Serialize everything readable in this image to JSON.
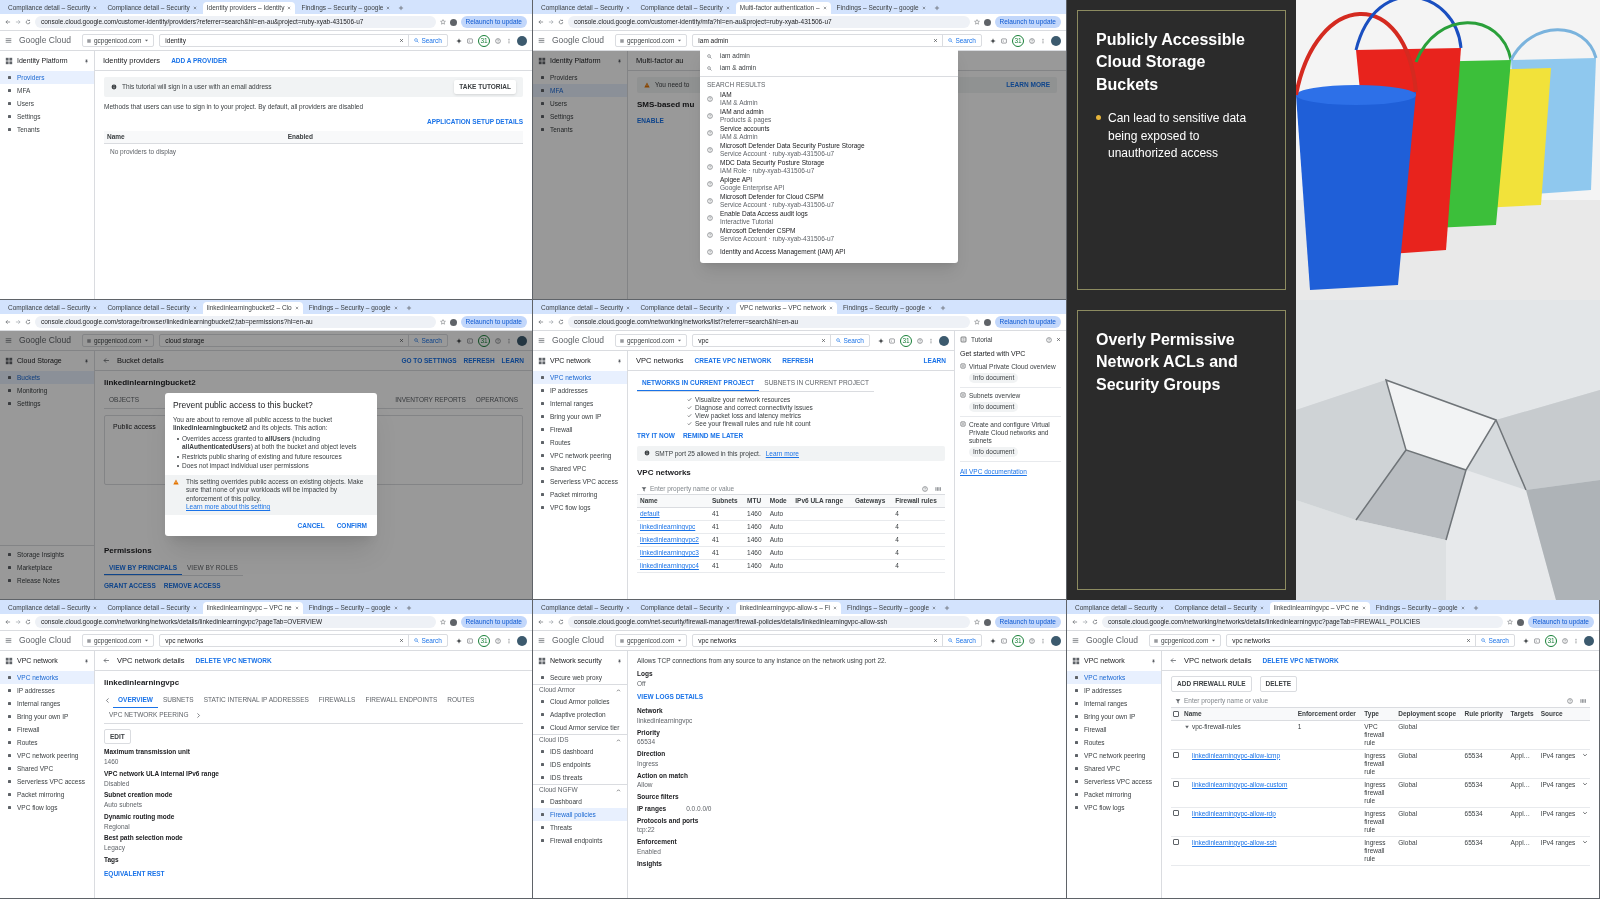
{
  "tiles": [
    {
      "kind": "browser",
      "tabs": [
        {
          "title": "Compliance detail – Security",
          "selected": false
        },
        {
          "title": "Compliance detail – Security",
          "selected": false
        },
        {
          "title": "Identity providers – Identity",
          "selected": true
        },
        {
          "title": "Findings – Security – google",
          "selected": false
        }
      ],
      "url": "console.cloud.google.com/customer-identity/providers?referrer=search&hl=en-au&project=ruby-xyab-431506-u7",
      "project": "gcpgenicod.com",
      "logo": "Google Cloud",
      "search": "identity",
      "search_button": "Search",
      "notifications": "31",
      "relaunch": "Relaunch to update",
      "product": "Identity Platform",
      "sidebar": [
        {
          "label": "Providers",
          "selected": true
        },
        {
          "label": "MFA",
          "selected": false
        },
        {
          "label": "Users",
          "selected": false
        },
        {
          "label": "Settings",
          "selected": false
        },
        {
          "label": "Tenants",
          "selected": false
        }
      ],
      "header": {
        "title": "Identity providers",
        "actions": [
          {
            "text": "ADD A PROVIDER"
          }
        ]
      },
      "blocks": [
        {
          "kind": "banner",
          "text": "This tutorial will sign in a user with an email address",
          "action": "TAKE TUTORIAL"
        },
        {
          "kind": "text",
          "text": "Methods that users can use to sign in to your project. By default, all providers are disabled"
        },
        {
          "kind": "action-right",
          "text": "APPLICATION SETUP DETAILS"
        },
        {
          "kind": "table",
          "columns": [
            "Name",
            "Enabled"
          ],
          "empty": "No providers to display"
        }
      ]
    },
    {
      "kind": "browser",
      "tabs": [
        {
          "title": "Compliance detail – Security",
          "selected": false
        },
        {
          "title": "Compliance detail – Security",
          "selected": false
        },
        {
          "title": "Multi-factor authentication –",
          "selected": true
        },
        {
          "title": "Findings – Security – google",
          "selected": false
        }
      ],
      "url": "console.cloud.google.com/customer-identity/mfa?hl=en-au&project=ruby-xyab-431506-u7",
      "project": "gcpgenicod.com",
      "logo": "Google Cloud",
      "search": "iam admin",
      "search_button": "Search",
      "notifications": "31",
      "relaunch": "Relaunch to update",
      "product": "Identity Platform",
      "sidebar": [
        {
          "label": "Providers",
          "selected": false
        },
        {
          "label": "MFA",
          "selected": true
        },
        {
          "label": "Users",
          "selected": false
        },
        {
          "label": "Settings",
          "selected": false
        },
        {
          "label": "Tenants",
          "selected": false
        }
      ],
      "header": {
        "title": "Multi-factor au"
      },
      "blocks": [
        {
          "kind": "banner-warning",
          "text": "You need to",
          "action": "LEARN MORE"
        },
        {
          "kind": "heading",
          "text": "SMS-based mu"
        },
        {
          "kind": "action",
          "text": "ENABLE"
        }
      ],
      "overlay": {
        "kind": "dropdown",
        "suggestions": [
          "iam admin",
          "iam & admin"
        ],
        "section": "SEARCH RESULTS",
        "results": [
          {
            "title": "IAM",
            "subtitle": "IAM & Admin"
          },
          {
            "title": "IAM and admin",
            "subtitle": "Products & pages"
          },
          {
            "title": "Service accounts",
            "subtitle": "IAM & Admin"
          },
          {
            "title": "Microsoft Defender Data Security Posture Storage",
            "subtitle": "Service Account · ruby-xyab-431506-u7"
          },
          {
            "title": "MDC Data Security Posture Storage",
            "subtitle": "IAM Role · ruby-xyab-431506-u7"
          },
          {
            "title": "Apigee API",
            "subtitle": "Google Enterprise API"
          },
          {
            "title": "Microsoft Defender for Cloud CSPM",
            "subtitle": "Service Account · ruby-xyab-431506-u7"
          },
          {
            "title": "Enable Data Access audit logs",
            "subtitle": "Interactive Tutorial"
          },
          {
            "title": "Microsoft Defender CSPM",
            "subtitle": "Service Account · ruby-xyab-431506-u7"
          },
          {
            "title": "Identity and Access Management (IAM) API"
          }
        ]
      }
    },
    {
      "kind": "slide",
      "title": "Publicly Accessible Cloud Storage Buckets",
      "bullets": [
        "Can lead to sensitive data being exposed to unauthorized access"
      ]
    },
    {
      "kind": "browser",
      "tabs": [
        {
          "title": "Compliance detail – Security",
          "selected": false
        },
        {
          "title": "Compliance detail – Security",
          "selected": false
        },
        {
          "title": "linkedinlearningbucket2 – Clo",
          "selected": true
        },
        {
          "title": "Findings – Security – google",
          "selected": false
        }
      ],
      "url": "console.cloud.google.com/storage/browser/linkedinlearningbucket2;tab=permissions?hl=en-au",
      "project": "gcpgenicod.com",
      "logo": "Google Cloud",
      "search": "cloud storage",
      "search_button": "Search",
      "notifications": "31",
      "relaunch": "Relaunch to update",
      "product": "Cloud Storage",
      "sidebar": [
        {
          "label": "Buckets",
          "selected": true
        },
        {
          "label": "Monitoring",
          "selected": false
        },
        {
          "label": "Settings",
          "selected": false
        }
      ],
      "sidebar_bottom": [
        {
          "label": "Storage Insights",
          "selected": false
        },
        {
          "label": "Marketplace",
          "selected": false
        },
        {
          "label": "Release Notes",
          "selected": false
        }
      ],
      "header": {
        "title": "Bucket details",
        "back": true,
        "right_actions": [
          {
            "text": "GO TO SETTINGS"
          },
          {
            "text": "REFRESH"
          },
          {
            "text": "LEARN"
          }
        ]
      },
      "blocks": [
        {
          "kind": "heading",
          "text": "linkedinlearningbucket2"
        },
        {
          "kind": "tabs",
          "items": [
            {
              "label": "OBJECTS",
              "selected": false
            },
            {
              "label": "INVENTORY REPORTS",
              "selected": false,
              "gap_before": true
            },
            {
              "label": "OPERATIONS",
              "selected": false
            }
          ]
        },
        {
          "kind": "card",
          "heading": "Public access"
        }
      ],
      "footer_blocks": [
        {
          "kind": "heading",
          "text": "Permissions"
        },
        {
          "kind": "tabs",
          "items": [
            {
              "label": "VIEW BY PRINCIPALS",
              "selected": true
            },
            {
              "label": "VIEW BY ROLES",
              "selected": false
            }
          ]
        },
        {
          "kind": "buttons",
          "items": [
            "GRANT ACCESS",
            "REMOVE ACCESS"
          ]
        }
      ],
      "overlay": {
        "kind": "modal",
        "title": "Prevent public access to this bucket?",
        "text": "You are about to remove all public access to the bucket **linkedinlearningbucket2** and its objects. This action:",
        "bullets": [
          "Overrides access granted to **allUsers** (including **allAuthenticatedUsers**) at both the bucket and object levels",
          "Restricts public sharing of existing and future resources",
          "Does not impact individual user permissions"
        ],
        "warning": "This setting overrides public access on existing objects. Make sure that none of your workloads will be impacted by enforcement of this policy.",
        "warning_link": "Learn more about this setting",
        "buttons": [
          "CANCEL",
          "CONFIRM"
        ]
      }
    },
    {
      "kind": "browser",
      "tabs": [
        {
          "title": "Compliance detail – Security",
          "selected": false
        },
        {
          "title": "Compliance detail – Security",
          "selected": false
        },
        {
          "title": "VPC networks – VPC network",
          "selected": true
        },
        {
          "title": "Findings – Security – google",
          "selected": false
        }
      ],
      "url": "console.cloud.google.com/networking/networks/list?referrer=search&hl=en-au",
      "project": "gcpgenicod.com",
      "logo": "Google Cloud",
      "search": "vpc",
      "search_button": "Search",
      "notifications": "31",
      "relaunch": "Relaunch to update",
      "product": "VPC network",
      "sidebar": [
        {
          "label": "VPC networks",
          "selected": true
        },
        {
          "label": "IP addresses",
          "selected": false
        },
        {
          "label": "Internal ranges",
          "selected": false
        },
        {
          "label": "Bring your own IP",
          "selected": false
        },
        {
          "label": "Firewall",
          "selected": false
        },
        {
          "label": "Routes",
          "selected": false
        },
        {
          "label": "VPC network peering",
          "selected": false
        },
        {
          "label": "Shared VPC",
          "selected": false
        },
        {
          "label": "Serverless VPC access",
          "selected": false
        },
        {
          "label": "Packet mirroring",
          "selected": false
        },
        {
          "label": "VPC flow logs",
          "selected": false
        }
      ],
      "header": {
        "title": "VPC networks",
        "actions": [
          {
            "text": "CREATE VPC NETWORK"
          },
          {
            "text": "REFRESH"
          }
        ],
        "right_actions": [
          {
            "text": "LEARN"
          }
        ]
      },
      "blocks": [
        {
          "kind": "tabs",
          "items": [
            {
              "label": "NETWORKS IN CURRENT PROJECT",
              "selected": true
            },
            {
              "label": "SUBNETS IN CURRENT PROJECT",
              "selected": false
            }
          ]
        },
        {
          "kind": "checklist",
          "items": [
            "Visualize your network resources",
            "Diagnose and correct connectivity issues",
            "View packet loss and latency metrics",
            "See your firewall rules and rule hit count"
          ]
        },
        {
          "kind": "buttons",
          "items": [
            "TRY IT NOW",
            "REMIND ME LATER"
          ]
        },
        {
          "kind": "banner",
          "text": "SMTP port 25 allowed in this project.",
          "link": "Learn more"
        },
        {
          "kind": "heading",
          "text": "VPC networks"
        },
        {
          "kind": "table",
          "filter": "Enter property name or value",
          "columns": [
            "Name",
            "Subnets",
            "MTU",
            "Mode",
            "IPv6 ULA range",
            "Gateways",
            "Firewall rules"
          ],
          "rows": [
            {
              "kind": "row",
              "cells": [
                "default",
                "41",
                "1460",
                "Auto",
                null,
                null,
                "4"
              ]
            },
            {
              "kind": "row",
              "cells": [
                "linkedinlearningvpc",
                "41",
                "1460",
                "Auto",
                null,
                null,
                "4"
              ]
            },
            {
              "kind": "row",
              "cells": [
                "linkedinlearningvpc2",
                "41",
                "1460",
                "Auto",
                null,
                null,
                "4"
              ]
            },
            {
              "kind": "row",
              "cells": [
                "linkedinlearningvpc3",
                "41",
                "1460",
                "Auto",
                null,
                null,
                "4"
              ]
            },
            {
              "kind": "row",
              "cells": [
                "linkedinlearningvpc4",
                "41",
                "1460",
                "Auto",
                null,
                null,
                "4"
              ]
            }
          ]
        }
      ],
      "panel": {
        "label": "Tutorial",
        "title": "Get started with VPC",
        "items": [
          {
            "title": "Virtual Private Cloud overview",
            "badge": "Info document"
          },
          {
            "title": "Subnets overview",
            "badge": "Info document"
          },
          {
            "title": "Create and configure Virtual Private Cloud networks and subnets",
            "badge": "Info document"
          }
        ],
        "link": "All VPC documentation"
      }
    },
    {
      "kind": "slide",
      "title": "Overly Permissive Network ACLs and Security Groups"
    },
    {
      "kind": "browser",
      "tabs": [
        {
          "title": "Compliance detail – Security",
          "selected": false
        },
        {
          "title": "Compliance detail – Security",
          "selected": false
        },
        {
          "title": "linkedinlearningvpc – VPC ne",
          "selected": true
        },
        {
          "title": "Findings – Security – google",
          "selected": false
        }
      ],
      "url": "console.cloud.google.com/networking/networks/details/linkedinlearningvpc?pageTab=OVERVIEW",
      "project": "gcpgenicod.com",
      "logo": "Google Cloud",
      "search": "vpc networks",
      "search_button": "Search",
      "notifications": "31",
      "relaunch": "Relaunch to update",
      "product": "VPC network",
      "sidebar": [
        {
          "label": "VPC networks",
          "selected": true
        },
        {
          "label": "IP addresses",
          "selected": false
        },
        {
          "label": "Internal ranges",
          "selected": false
        },
        {
          "label": "Bring your own IP",
          "selected": false
        },
        {
          "label": "Firewall",
          "selected": false
        },
        {
          "label": "Routes",
          "selected": false
        },
        {
          "label": "VPC network peering",
          "selected": false
        },
        {
          "label": "Shared VPC",
          "selected": false
        },
        {
          "label": "Serverless VPC access",
          "selected": false
        },
        {
          "label": "Packet mirroring",
          "selected": false
        },
        {
          "label": "VPC flow logs",
          "selected": false
        }
      ],
      "header": {
        "title": "VPC network details",
        "back": true,
        "actions": [
          {
            "text": "DELETE VPC NETWORK"
          }
        ]
      },
      "blocks": [
        {
          "kind": "heading",
          "text": "linkedinlearningvpc"
        },
        {
          "kind": "tabs",
          "arrows": true,
          "items": [
            {
              "label": "OVERVIEW",
              "selected": true
            },
            {
              "label": "SUBNETS",
              "selected": false
            },
            {
              "label": "STATIC INTERNAL IP ADDRESSES",
              "selected": false
            },
            {
              "label": "FIREWALLS",
              "selected": false
            },
            {
              "label": "FIREWALL ENDPOINTS",
              "selected": false
            },
            {
              "label": "ROUTES",
              "selected": false
            },
            {
              "label": "VPC NETWORK PEERING",
              "selected": false
            }
          ]
        },
        {
          "kind": "buttons",
          "outlined": true,
          "items": [
            "EDIT"
          ]
        },
        {
          "kind": "field",
          "label": "Maximum transmission unit",
          "value": "1460"
        },
        {
          "kind": "field",
          "label": "VPC network ULA internal IPv6 range",
          "value": "Disabled"
        },
        {
          "kind": "field",
          "label": "Subnet creation mode",
          "value": "Auto subnets"
        },
        {
          "kind": "field",
          "label": "Dynamic routing mode",
          "value": "Regional"
        },
        {
          "kind": "field",
          "label": "Best path selection mode",
          "value": "Legacy"
        },
        {
          "kind": "field",
          "label": "Tags"
        },
        {
          "kind": "action",
          "text": "EQUIVALENT REST"
        }
      ]
    },
    {
      "kind": "browser",
      "tabs": [
        {
          "title": "Compliance detail – Security",
          "selected": false
        },
        {
          "title": "Compliance detail – Security",
          "selected": false
        },
        {
          "title": "linkedinlearningvpc-allow-s – Fi",
          "selected": true
        },
        {
          "title": "Findings – Security – google",
          "selected": false
        }
      ],
      "url": "console.cloud.google.com/net-security/firewall-manager/firewall-policies/details/linkedinlearningvpc-allow-ssh",
      "project": "gcpgenicod.com",
      "logo": "Google Cloud",
      "search": "vpc networks",
      "search_button": "Search",
      "notifications": "31",
      "relaunch": "Relaunch to update",
      "product": "Network security",
      "sidebar": [
        {
          "label": "Secure web proxy",
          "selected": false
        },
        {
          "kind": "group",
          "label": "Cloud Armor"
        },
        {
          "label": "Cloud Armor policies",
          "selected": false
        },
        {
          "label": "Adaptive protection",
          "selected": false
        },
        {
          "label": "Cloud Armor service tier",
          "selected": false
        },
        {
          "kind": "group",
          "label": "Cloud IDS"
        },
        {
          "label": "IDS dashboard",
          "selected": false
        },
        {
          "label": "IDS endpoints",
          "selected": false
        },
        {
          "label": "IDS threats",
          "selected": false
        },
        {
          "kind": "group",
          "label": "Cloud NGFW"
        },
        {
          "label": "Dashboard",
          "selected": false
        },
        {
          "label": "Firewall policies",
          "selected": true
        },
        {
          "label": "Threats",
          "selected": false
        },
        {
          "label": "Firewall endpoints",
          "selected": false
        }
      ],
      "blocks": [
        {
          "kind": "text",
          "text": "Allows TCP connections from any source to any instance on the network using port 22."
        },
        {
          "kind": "field",
          "label": "Logs",
          "value": "Off"
        },
        {
          "kind": "action",
          "text": "VIEW LOGS DETAILS"
        },
        {
          "kind": "field",
          "label": "Network",
          "value": "linkedinlearningvpc"
        },
        {
          "kind": "field",
          "label": "Priority",
          "value": "65534"
        },
        {
          "kind": "field",
          "label": "Direction",
          "value": "Ingress"
        },
        {
          "kind": "field",
          "label": "Action on match",
          "value": "Allow"
        },
        {
          "kind": "field",
          "label": "Source filters"
        },
        {
          "kind": "pair",
          "label": "IP ranges",
          "value": "0.0.0.0/0"
        },
        {
          "kind": "field",
          "label": "Protocols and ports",
          "value": "tcp:22"
        },
        {
          "kind": "field",
          "label": "Enforcement",
          "value": "Enabled"
        },
        {
          "kind": "field",
          "label": "Insights"
        }
      ]
    },
    {
      "kind": "browser",
      "tabs": [
        {
          "title": "Compliance detail – Security",
          "selected": false
        },
        {
          "title": "Compliance detail – Security",
          "selected": false
        },
        {
          "title": "linkedinlearningvpc – VPC ne",
          "selected": true
        },
        {
          "title": "Findings – Security – google",
          "selected": false
        }
      ],
      "url": "console.cloud.google.com/networking/networks/details/linkedinlearningvpc?pageTab=FIREWALL_POLICIES",
      "project": "gcpgenicod.com",
      "logo": "Google Cloud",
      "search": "vpc networks",
      "search_button": "Search",
      "notifications": "31",
      "relaunch": "Relaunch to update",
      "product": "VPC network",
      "sidebar": [
        {
          "label": "VPC networks",
          "selected": true
        },
        {
          "label": "IP addresses",
          "selected": false
        },
        {
          "label": "Internal ranges",
          "selected": false
        },
        {
          "label": "Bring your own IP",
          "selected": false
        },
        {
          "label": "Firewall",
          "selected": false
        },
        {
          "label": "Routes",
          "selected": false
        },
        {
          "label": "VPC network peering",
          "selected": false
        },
        {
          "label": "Shared VPC",
          "selected": false
        },
        {
          "label": "Serverless VPC access",
          "selected": false
        },
        {
          "label": "Packet mirroring",
          "selected": false
        },
        {
          "label": "VPC flow logs",
          "selected": false
        }
      ],
      "header": {
        "title": "VPC network details",
        "back": true,
        "actions": [
          {
            "text": "DELETE VPC NETWORK"
          }
        ]
      },
      "blocks": [
        {
          "kind": "buttons",
          "outlined": true,
          "items": [
            "ADD FIREWALL RULE",
            "DELETE"
          ]
        },
        {
          "kind": "table",
          "filter": "Enter property name or value",
          "all_checked": false,
          "columns": [
            "Name",
            "Enforcement order",
            "Type",
            "Deployment scope",
            "Rule priority",
            "Targets",
            "Source"
          ],
          "rows": [
            {
              "kind": "group",
              "expanded": true,
              "cells": [
                "vpc-firewall-rules",
                "1",
                "VPC firewall rule",
                "Global",
                null,
                null,
                null
              ]
            },
            {
              "kind": "row",
              "checked": false,
              "cells": [
                "linkedinlearningvpc-allow-icmp",
                null,
                "Ingress firewall rule",
                "Global",
                "65534",
                "Appl…",
                "IPv4 ranges"
              ]
            },
            {
              "kind": "row",
              "checked": false,
              "cells": [
                "linkedinlearningvpc-allow-custom",
                null,
                "Ingress firewall rule",
                "Global",
                "65534",
                "Appl…",
                "IPv4 ranges"
              ]
            },
            {
              "kind": "row",
              "checked": false,
              "cells": [
                "linkedinlearningvpc-allow-rdp",
                null,
                "Ingress firewall rule",
                "Global",
                "65534",
                "Appl…",
                "IPv4 ranges"
              ]
            },
            {
              "kind": "row",
              "checked": false,
              "cells": [
                "linkedinlearningvpc-allow-ssh",
                null,
                "Ingress firewall rule",
                "Global",
                "65534",
                "Appl…",
                "IPv4 ranges"
              ]
            }
          ]
        }
      ]
    }
  ]
}
